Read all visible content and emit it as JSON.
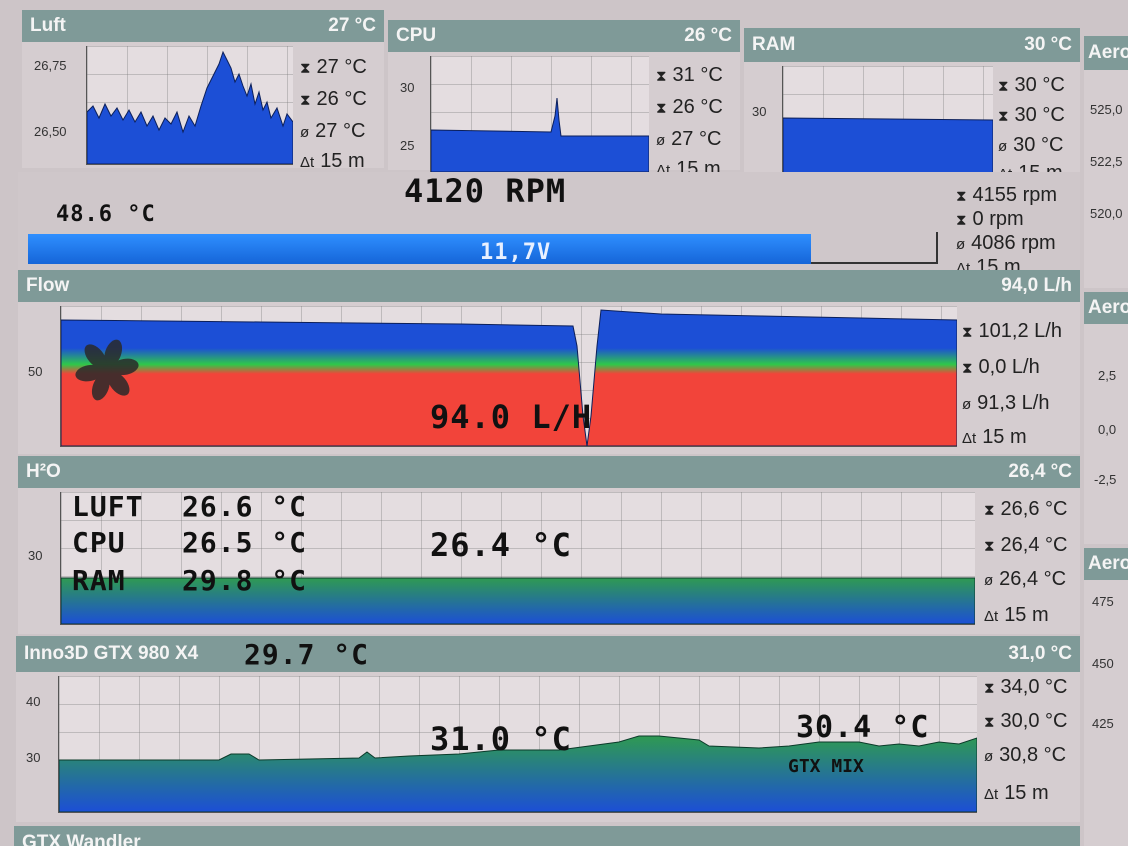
{
  "luft": {
    "title": "Luft",
    "value": "27 °C",
    "ticks": [
      "26,75",
      "26,50"
    ],
    "stats": {
      "max": "27 °C",
      "min": "26 °C",
      "avg": "27 °C",
      "dt": "15 m"
    }
  },
  "cpu": {
    "title": "CPU",
    "value": "26 °C",
    "ticks": [
      "30",
      "25"
    ],
    "stats": {
      "max": "31 °C",
      "min": "26 °C",
      "avg": "27 °C",
      "dt": "15 m"
    }
  },
  "ram": {
    "title": "RAM",
    "value": "30 °C",
    "ticks": [
      "30"
    ],
    "stats": {
      "max": "30 °C",
      "min": "30 °C",
      "avg": "30 °C",
      "dt": "15 m"
    }
  },
  "aero1": {
    "title": "Aero",
    "ticks": [
      "525,0",
      "522,5",
      "520,0"
    ]
  },
  "aero2": {
    "title": "Aero",
    "ticks": [
      "2,5",
      "0,0",
      "-2,5"
    ]
  },
  "aero3": {
    "title": "Aero",
    "ticks": [
      "475",
      "450",
      "425"
    ]
  },
  "fan": {
    "rpm": "4120 RPM",
    "temp": "48.6 °C",
    "voltage": "11,7V",
    "voltage_fill": 0.86,
    "stats": {
      "max": "4155 rpm",
      "min": "0 rpm",
      "avg": "4086 rpm",
      "dt": "15 m"
    }
  },
  "flow": {
    "title": "Flow",
    "value": "94,0 L/h",
    "tick": "50",
    "big": "94.0 L/H",
    "stats": {
      "max": "101,2 L/h",
      "min": "0,0 L/h",
      "avg": "91,3 L/h",
      "dt": "15 m"
    }
  },
  "h2o": {
    "title": "H²O",
    "value": "26,4 °C",
    "tick": "30",
    "big": "26.4 °C",
    "rows": [
      {
        "label": "LUFT",
        "value": "26.6 °C"
      },
      {
        "label": "CPU",
        "value": "26.5 °C"
      },
      {
        "label": "RAM",
        "value": "29.8 °C"
      }
    ],
    "stats": {
      "max": "26,6 °C",
      "min": "26,4 °C",
      "avg": "26,4 °C",
      "dt": "15 m"
    }
  },
  "gpu": {
    "title": "Inno3D GTX 980 X4",
    "title_reading": "29.7 °C",
    "value": "31,0 °C",
    "ticks": [
      "40",
      "30"
    ],
    "big": "31.0 °C",
    "mix_value": "30.4 °C",
    "mix_label": "GTX MIX",
    "stats": {
      "max": "34,0 °C",
      "min": "30,0 °C",
      "avg": "30,8 °C",
      "dt": "15 m"
    }
  },
  "next_panel": {
    "title": "GTX Wandler"
  },
  "icons": {
    "max": "max-arrow-icon",
    "min": "min-arrow-icon",
    "avg": "average-icon",
    "dt": "delta-time-icon",
    "fan": "fan-icon"
  },
  "colors": {
    "header": "#7f9a98",
    "blue": "#1c4fd6",
    "green": "#2fa84a",
    "red": "#f2443a"
  }
}
